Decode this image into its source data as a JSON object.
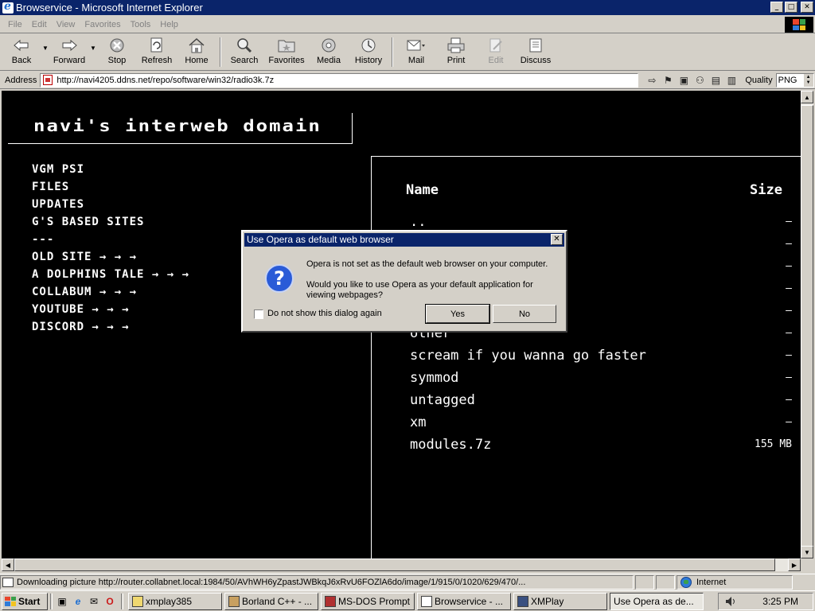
{
  "window": {
    "title": "Browservice - Microsoft Internet Explorer",
    "buttons": {
      "minimize": "_",
      "maximize": "□",
      "close": "✕"
    }
  },
  "menu": [
    "File",
    "Edit",
    "View",
    "Favorites",
    "Tools",
    "Help"
  ],
  "toolbar": {
    "back": "Back",
    "forward": "Forward",
    "stop": "Stop",
    "refresh": "Refresh",
    "home": "Home",
    "search": "Search",
    "favorites": "Favorites",
    "media": "Media",
    "history": "History",
    "mail": "Mail",
    "print": "Print",
    "edit": "Edit",
    "discuss": "Discuss"
  },
  "address": {
    "label": "Address",
    "url": "http://navi4205.ddns.net/repo/software/win32/radio3k.7z",
    "quality_label": "Quality",
    "quality_value": "PNG"
  },
  "page": {
    "site_title": "navi's interweb domain",
    "nav": [
      "VGM PSI",
      "FILES",
      "UPDATES",
      "G'S BASED SITES",
      "---",
      "OLD SITE → → →",
      "A DOLPHINS TALE → → →",
      "COLLABUM → → →",
      "YOUTUBE → → →",
      "DISCORD → → →"
    ],
    "columns": {
      "name": "Name",
      "size": "Size"
    },
    "files": [
      {
        "name": "..",
        "size": "—"
      },
      {
        "name": "",
        "size": "—"
      },
      {
        "name": "",
        "size": "—"
      },
      {
        "name": "",
        "size": "—"
      },
      {
        "name": "",
        "size": "—"
      },
      {
        "name": "other",
        "size": "—"
      },
      {
        "name": "scream if you wanna go faster",
        "size": "—"
      },
      {
        "name": "symmod",
        "size": "—"
      },
      {
        "name": "untagged",
        "size": "—"
      },
      {
        "name": "xm",
        "size": "—"
      },
      {
        "name": "modules.7z",
        "size": "155 MB"
      }
    ]
  },
  "dialog": {
    "title": "Use Opera as default web browser",
    "message1": "Opera is not set as the default web browser on your computer.",
    "message2": "Would you like to use Opera as your default application for viewing webpages?",
    "checkbox_label": "Do not show this dialog again",
    "yes": "Yes",
    "no": "No"
  },
  "status": {
    "text": "Downloading picture http://router.collabnet.local:1984/50/AVhWH6yZpastJWBkqJ6xRvU6FOZlA6do/image/1/915/0/1020/629/470/...",
    "zone": "Internet"
  },
  "taskbar": {
    "start": "Start",
    "tasks": [
      {
        "label": "xmplay385",
        "active": false
      },
      {
        "label": "Borland C++ - ...",
        "active": false
      },
      {
        "label": "MS-DOS Prompt",
        "active": false
      },
      {
        "label": "Browservice - ...",
        "active": false
      },
      {
        "label": "XMPlay",
        "active": false
      },
      {
        "label": "Use Opera as de...",
        "active": true
      }
    ],
    "clock": "3:25 PM"
  },
  "colors": {
    "titlebar": "#0a246a",
    "chrome": "#d4d0c8",
    "page_bg": "#000000",
    "page_text": "#ffffff"
  }
}
